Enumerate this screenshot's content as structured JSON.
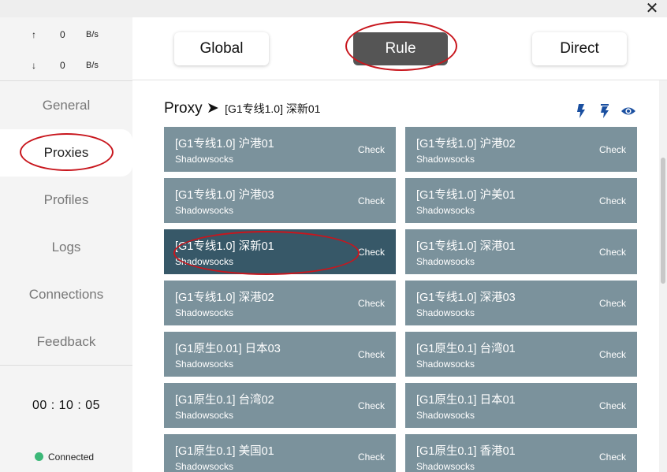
{
  "traffic": {
    "up": {
      "arrow": "↑",
      "value": "0",
      "unit": "B/s"
    },
    "down": {
      "arrow": "↓",
      "value": "0",
      "unit": "B/s"
    }
  },
  "nav": [
    {
      "label": "General"
    },
    {
      "label": "Proxies",
      "active": true
    },
    {
      "label": "Profiles"
    },
    {
      "label": "Logs"
    },
    {
      "label": "Connections"
    },
    {
      "label": "Feedback"
    }
  ],
  "timer": "00 : 10 : 05",
  "status": {
    "label": "Connected",
    "color": "#3cb878"
  },
  "modes": [
    {
      "label": "Global"
    },
    {
      "label": "Rule",
      "active": true
    },
    {
      "label": "Direct"
    }
  ],
  "proxy": {
    "title": "Proxy",
    "arrow": "➤",
    "selected": "[G1专线1.0] 深新01",
    "icons": [
      "lightning-icon",
      "lightning-timer-icon",
      "eye-icon"
    ]
  },
  "check_label": "Check",
  "proxies": [
    {
      "name": "[G1专线1.0] 沪港01",
      "type": "Shadowsocks"
    },
    {
      "name": "[G1专线1.0] 沪港02",
      "type": "Shadowsocks"
    },
    {
      "name": "[G1专线1.0] 沪港03",
      "type": "Shadowsocks"
    },
    {
      "name": "[G1专线1.0] 沪美01",
      "type": "Shadowsocks"
    },
    {
      "name": "[G1专线1.0] 深新01",
      "type": "Shadowsocks",
      "selected": true
    },
    {
      "name": "[G1专线1.0] 深港01",
      "type": "Shadowsocks"
    },
    {
      "name": "[G1专线1.0] 深港02",
      "type": "Shadowsocks"
    },
    {
      "name": "[G1专线1.0] 深港03",
      "type": "Shadowsocks"
    },
    {
      "name": "[G1原生0.01] 日本03",
      "type": "Shadowsocks"
    },
    {
      "name": "[G1原生0.1] 台湾01",
      "type": "Shadowsocks"
    },
    {
      "name": "[G1原生0.1] 台湾02",
      "type": "Shadowsocks"
    },
    {
      "name": "[G1原生0.1] 日本01",
      "type": "Shadowsocks"
    },
    {
      "name": "[G1原生0.1] 美国01",
      "type": "Shadowsocks"
    },
    {
      "name": "[G1原生0.1] 香港01",
      "type": "Shadowsocks"
    }
  ],
  "colors": {
    "card": "#7b929c",
    "card_selected": "#375868",
    "mode_active": "#555555",
    "icon_blue": "#1a4fa0",
    "annotation": "#c8161d"
  }
}
